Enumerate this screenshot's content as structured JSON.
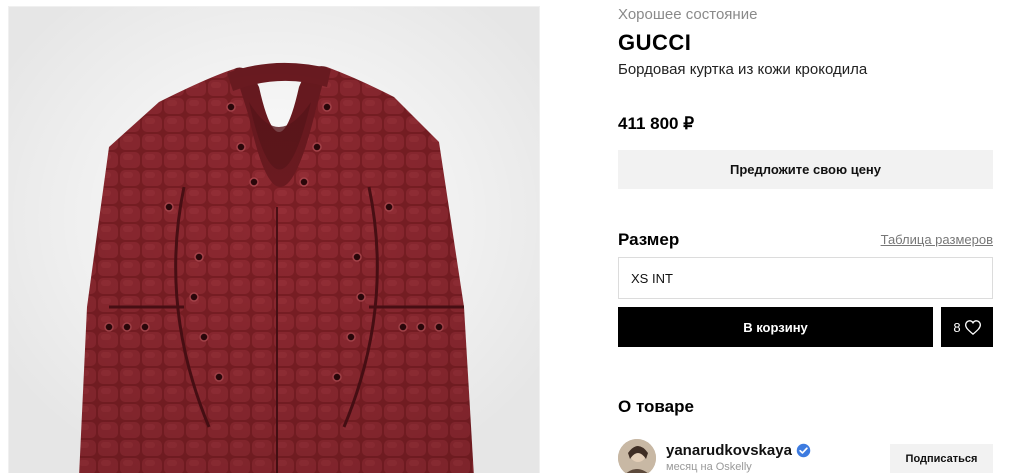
{
  "product": {
    "condition": "Хорошее состояние",
    "brand": "GUCCI",
    "title": "Бордовая куртка из кожи крокодила",
    "price": "411 800 ₽",
    "offer_label": "Предложите свою цену",
    "image_icon": "jacket-photo"
  },
  "size": {
    "label": "Размер",
    "chart_link": "Таблица размеров",
    "selected": "XS INT"
  },
  "cart": {
    "button_label": "В корзину",
    "likes_count": "8",
    "like_icon": "heart-icon"
  },
  "about": {
    "title": "О товаре"
  },
  "seller": {
    "name": "yanarudkovskaya",
    "verified_icon": "verified-badge-icon",
    "since": "месяц на Oskelly",
    "follow_label": "Подписаться"
  },
  "colors": {
    "jacket": "#7a1e24",
    "cart_button": "#000000",
    "offer_button": "#f2f2f2",
    "verified": "#3d7be0"
  }
}
